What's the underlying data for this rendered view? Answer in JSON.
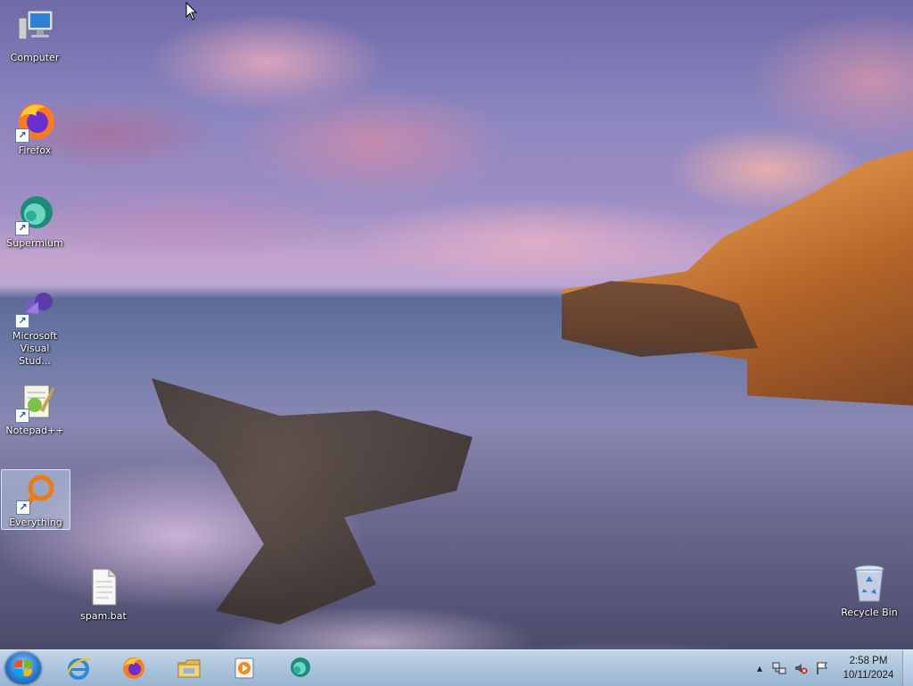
{
  "desktop": {
    "icons": [
      {
        "label": "Computer",
        "icon": "computer-icon",
        "shortcut": false,
        "selected": false
      },
      {
        "label": "Firefox",
        "icon": "firefox-icon",
        "shortcut": true,
        "selected": false
      },
      {
        "label": "Supermium",
        "icon": "supermium-icon",
        "shortcut": true,
        "selected": false
      },
      {
        "label": "Microsoft Visual Stud...",
        "icon": "visual-studio-icon",
        "shortcut": true,
        "selected": false
      },
      {
        "label": "Notepad++",
        "icon": "notepad-plus-plus-icon",
        "shortcut": true,
        "selected": false
      },
      {
        "label": "Everything",
        "icon": "everything-search-icon",
        "shortcut": true,
        "selected": true
      },
      {
        "label": "spam.bat",
        "icon": "batch-file-icon",
        "shortcut": false,
        "selected": false
      },
      {
        "label": "Recycle Bin",
        "icon": "recycle-bin-icon",
        "shortcut": false,
        "selected": false
      }
    ]
  },
  "taskbar": {
    "start": {
      "icon": "windows-start-icon"
    },
    "pinned": [
      {
        "icon": "internet-explorer-icon"
      },
      {
        "icon": "firefox-icon"
      },
      {
        "icon": "file-explorer-icon"
      },
      {
        "icon": "media-player-icon"
      },
      {
        "icon": "supermium-icon"
      }
    ],
    "tray": {
      "icons": [
        "show-hidden-icons-icon",
        "network-icon",
        "volume-muted-icon",
        "action-center-flag-icon"
      ],
      "time": "2:58 PM",
      "date": "10/11/2024"
    }
  },
  "colors": {
    "taskbar_top": "#c4d6e8",
    "taskbar_bottom": "#98b4d0",
    "selection": "#c8e1f5"
  }
}
